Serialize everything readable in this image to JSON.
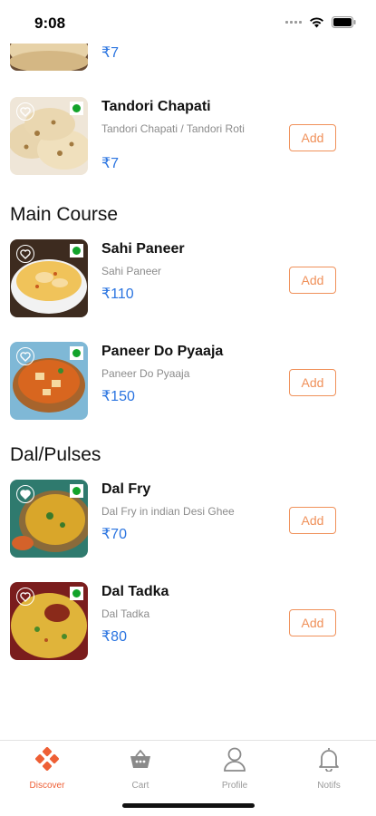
{
  "status_bar": {
    "time": "9:08"
  },
  "partial_item": {
    "price": "₹7"
  },
  "sections": [
    {
      "title": "",
      "items": [
        {
          "name": "Tandori Chapati",
          "description": "Tandori Chapati / Tandori Roti",
          "price": "₹7",
          "favorited": false,
          "veg": true
        }
      ]
    },
    {
      "title": "Main Course",
      "items": [
        {
          "name": "Sahi Paneer",
          "description": "Sahi Paneer",
          "price": "₹110",
          "favorited": false,
          "veg": true
        },
        {
          "name": "Paneer Do Pyaaja",
          "description": "Paneer Do Pyaaja",
          "price": "₹150",
          "favorited": false,
          "veg": true
        }
      ]
    },
    {
      "title": "Dal/Pulses",
      "items": [
        {
          "name": "Dal Fry",
          "description": "Dal Fry in indian Desi Ghee",
          "price": "₹70",
          "favorited": true,
          "veg": true
        },
        {
          "name": "Dal Tadka",
          "description": "Dal Tadka",
          "price": "₹80",
          "favorited": false,
          "veg": true
        }
      ]
    }
  ],
  "add_label": "Add",
  "tabs": [
    {
      "label": "Discover",
      "icon": "discover-icon",
      "active": true
    },
    {
      "label": "Cart",
      "icon": "basket-icon",
      "active": false
    },
    {
      "label": "Profile",
      "icon": "profile-icon",
      "active": false
    },
    {
      "label": "Notifs",
      "icon": "bell-icon",
      "active": false
    }
  ],
  "colors": {
    "accent": "#ee5f35",
    "add_button": "#f0915a",
    "price": "#2a74e0",
    "veg_dot": "#12a32a",
    "inactive_tab": "#9a9a9a"
  }
}
